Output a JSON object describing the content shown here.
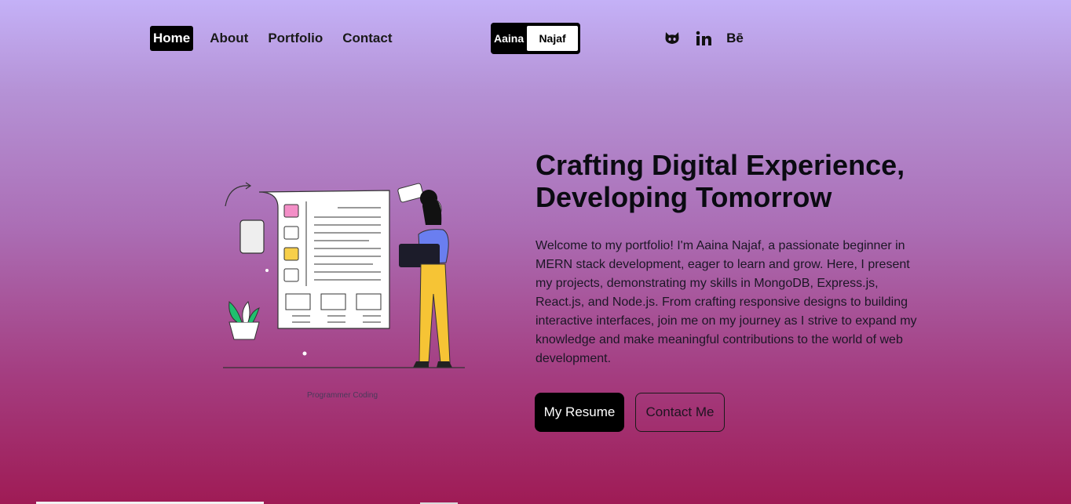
{
  "nav": {
    "items": [
      {
        "label": "Home",
        "active": true
      },
      {
        "label": "About",
        "active": false
      },
      {
        "label": "Portfolio",
        "active": false
      },
      {
        "label": "Contact",
        "active": false
      }
    ]
  },
  "logo": {
    "first": "Aaina",
    "last": "Najaf"
  },
  "socials": [
    {
      "icon": "github-icon"
    },
    {
      "icon": "linkedin-icon",
      "label": "in"
    },
    {
      "icon": "behance-icon",
      "label": "Bē"
    }
  ],
  "hero": {
    "headline_line1": "Crafting Digital Experience,",
    "headline_line2": "Developing Tomorrow",
    "intro": "Welcome to my portfolio! I'm Aaina Najaf, a passionate beginner in MERN stack development, eager to learn and grow. Here, I present my projects, demonstrating my skills in MongoDB, Express.js, React.js, and Node.js. From crafting responsive designs to building interactive interfaces, join me on my journey as I strive to expand my knowledge and make meaningful contributions to the world of web development.",
    "illustration_caption": "Programmer Coding",
    "resume_button": "My Resume",
    "contact_button": "Contact Me"
  },
  "colors": {
    "gradient_top": "#c4b1f7",
    "gradient_bottom": "#9f1b55",
    "button_dark": "#000000"
  }
}
